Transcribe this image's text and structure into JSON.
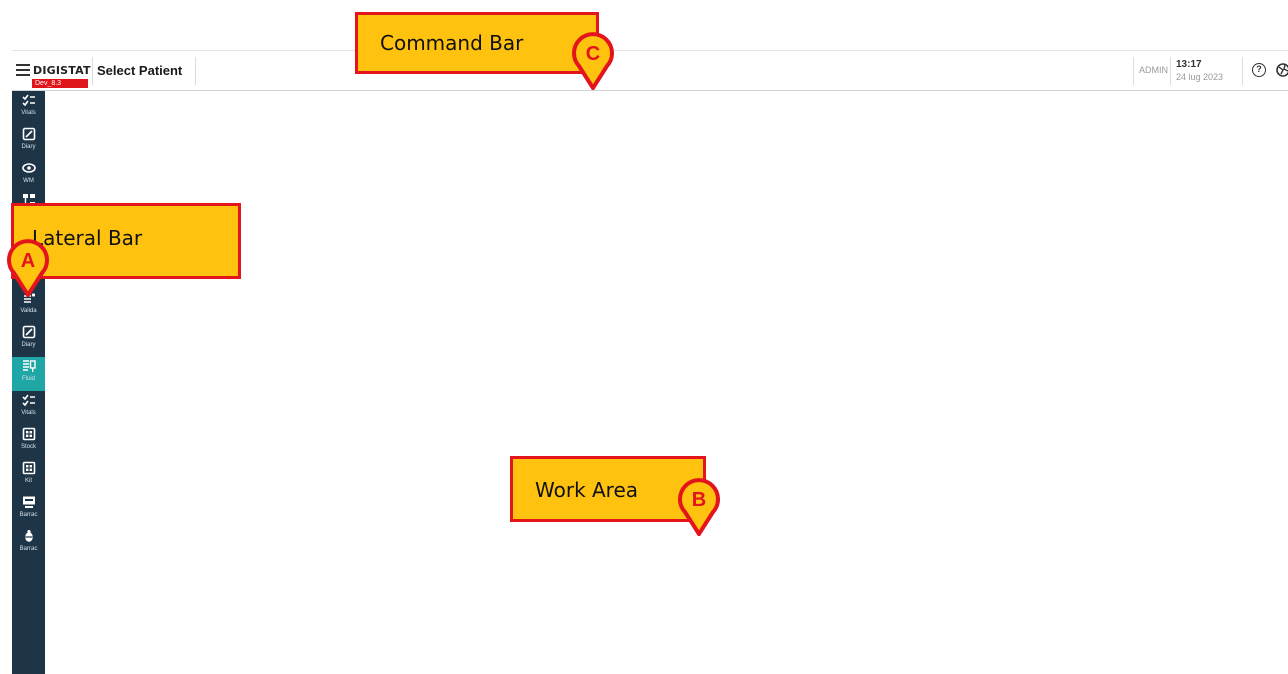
{
  "header": {
    "app_name": "DIGISTAT",
    "version": "Dev_8.3",
    "page_title": "Select Patient",
    "user": "ADMIN",
    "time": "13:17",
    "date": "24 lug 2023"
  },
  "sidebar": {
    "items": [
      {
        "label": "Vitals",
        "icon": "checklist-icon",
        "active": false
      },
      {
        "label": "Diary",
        "icon": "edit-square-icon",
        "active": false
      },
      {
        "label": "WM",
        "icon": "eye-icon",
        "active": false
      },
      {
        "label": "",
        "icon": "network-icon",
        "active": false
      },
      {
        "label": "Valida",
        "icon": "list-check-icon",
        "active": false
      },
      {
        "label": "Diary",
        "icon": "edit-square-icon",
        "active": false
      },
      {
        "label": "Fluid",
        "icon": "fluid-balance-icon",
        "active": true
      },
      {
        "label": "Vitals",
        "icon": "checklist-icon",
        "active": false
      },
      {
        "label": "Stock",
        "icon": "grid-box-icon",
        "active": false
      },
      {
        "label": "Kit",
        "icon": "grid-box-icon",
        "active": false
      },
      {
        "label": "Barrac",
        "icon": "monitor-icon",
        "active": false
      },
      {
        "label": "Barrac",
        "icon": "bug-icon",
        "active": false
      }
    ]
  },
  "callouts": {
    "command_bar": {
      "text": "Command Bar",
      "letter": "C"
    },
    "lateral_bar": {
      "text": "Lateral Bar",
      "letter": "A"
    },
    "work_area": {
      "text": "Work Area",
      "letter": "B"
    }
  },
  "colors": {
    "sidebar_bg": "#1e3547",
    "sidebar_active": "#1fa7a5",
    "callout_fill": "#ffc20e",
    "callout_border": "#e3141b",
    "version_badge": "#e0141b"
  }
}
